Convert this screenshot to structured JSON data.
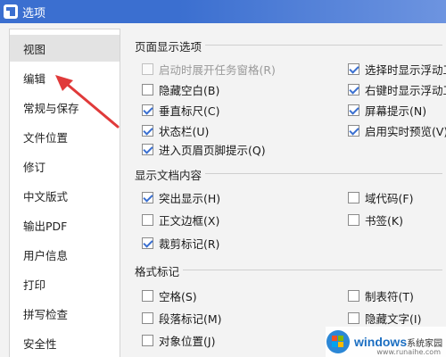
{
  "window": {
    "title": "选项"
  },
  "sidebar": {
    "items": [
      {
        "label": "视图",
        "selected": true
      },
      {
        "label": "编辑",
        "selected": false
      },
      {
        "label": "常规与保存",
        "selected": false
      },
      {
        "label": "文件位置",
        "selected": false
      },
      {
        "label": "修订",
        "selected": false
      },
      {
        "label": "中文版式",
        "selected": false
      },
      {
        "label": "输出PDF",
        "selected": false
      },
      {
        "label": "用户信息",
        "selected": false
      },
      {
        "label": "打印",
        "selected": false
      },
      {
        "label": "拼写检查",
        "selected": false
      },
      {
        "label": "安全性",
        "selected": false
      }
    ]
  },
  "page_display": {
    "title": "页面显示选项",
    "left": [
      {
        "label": "启动时展开任务窗格(R)",
        "checked": false,
        "disabled": true
      },
      {
        "label": "隐藏空白(B)",
        "checked": false,
        "disabled": false
      },
      {
        "label": "垂直标尺(C)",
        "checked": true,
        "disabled": false
      },
      {
        "label": "状态栏(U)",
        "checked": true,
        "disabled": false
      },
      {
        "label": "进入页眉页脚提示(Q)",
        "checked": true,
        "disabled": false
      }
    ],
    "right": [
      {
        "label": "选择时显示浮动工",
        "checked": true,
        "disabled": false
      },
      {
        "label": "右键时显示浮动工",
        "checked": true,
        "disabled": false
      },
      {
        "label": "屏幕提示(N)",
        "checked": true,
        "disabled": false
      },
      {
        "label": "启用实时预览(V)",
        "checked": true,
        "disabled": false
      }
    ]
  },
  "doc_content": {
    "title": "显示文档内容",
    "left": [
      {
        "label": "突出显示(H)",
        "checked": true
      },
      {
        "label": "正文边框(X)",
        "checked": false
      },
      {
        "label": "裁剪标记(R)",
        "checked": true
      }
    ],
    "right": [
      {
        "label": "域代码(F)",
        "checked": false
      },
      {
        "label": "书签(K)",
        "checked": false
      }
    ]
  },
  "format_marks": {
    "title": "格式标记",
    "left": [
      {
        "label": "空格(S)",
        "checked": false
      },
      {
        "label": "段落标记(M)",
        "checked": false
      },
      {
        "label": "对象位置(J)",
        "checked": false
      }
    ],
    "right": [
      {
        "label": "制表符(T)",
        "checked": false
      },
      {
        "label": "隐藏文字(I)",
        "checked": false
      }
    ]
  },
  "watermark": {
    "brand": "windows",
    "suffix": "系统家园",
    "url": "www.runaihe.com"
  },
  "colors": {
    "titlebar": "#3b6fd0",
    "arrow": "#e03a3a",
    "checkmark": "#3a6fd0"
  }
}
